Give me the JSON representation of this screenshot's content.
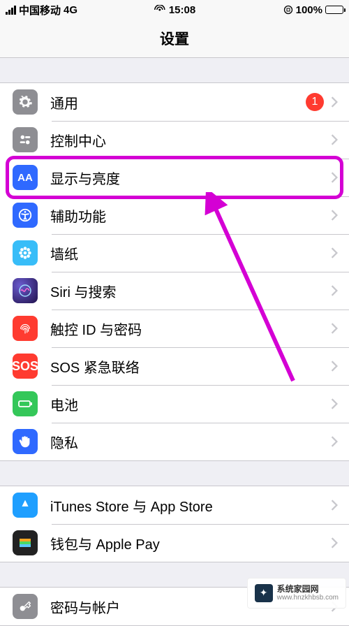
{
  "status": {
    "carrier": "中国移动",
    "network": "4G",
    "time": "15:08",
    "orientation_lock": "⊘",
    "battery_percent": "100%"
  },
  "nav": {
    "title": "设置"
  },
  "sections": {
    "s1": [
      {
        "label": "通用",
        "badge": "1"
      },
      {
        "label": "控制中心"
      },
      {
        "label": "显示与亮度"
      },
      {
        "label": "辅助功能"
      },
      {
        "label": "墙纸"
      },
      {
        "label": "Siri 与搜索"
      },
      {
        "label": "触控 ID 与密码"
      },
      {
        "label": "SOS 紧急联络"
      },
      {
        "label": "电池"
      },
      {
        "label": "隐私"
      }
    ],
    "s2": [
      {
        "label": "iTunes Store 与 App Store"
      },
      {
        "label": "钱包与 Apple Pay"
      }
    ],
    "s3": [
      {
        "label": "密码与帐户"
      }
    ]
  },
  "icons": {
    "sos": "SOS",
    "display": "AA"
  },
  "watermark": {
    "cn": "系统家园网",
    "domain": "www.hnzkhbsb.com"
  }
}
